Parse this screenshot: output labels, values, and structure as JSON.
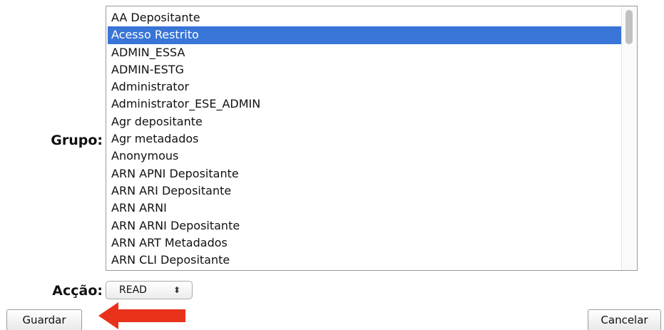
{
  "form": {
    "group_label": "Grupo:",
    "action_label": "Acção:",
    "groups": [
      "AA Depositante",
      "Acesso Restrito",
      "ADMIN_ESSA",
      "ADMIN-ESTG",
      "Administrator",
      "Administrator_ESE_ADMIN",
      "Agr depositante",
      "Agr metadados",
      "Anonymous",
      "ARN APNI Depositante",
      "ARN ARI Depositante",
      "ARN ARNI",
      "ARN ARNI Depositante",
      "ARN ART Metadados",
      "ARN CLI Depositante"
    ],
    "selected_group": "Acesso Restrito",
    "action_value": "READ",
    "select_arrows_glyph": "⬍"
  },
  "buttons": {
    "save_label": "Guardar",
    "cancel_label": "Cancelar"
  },
  "colors": {
    "selection": "#3875d7",
    "annotation_arrow": "#e8321c"
  }
}
